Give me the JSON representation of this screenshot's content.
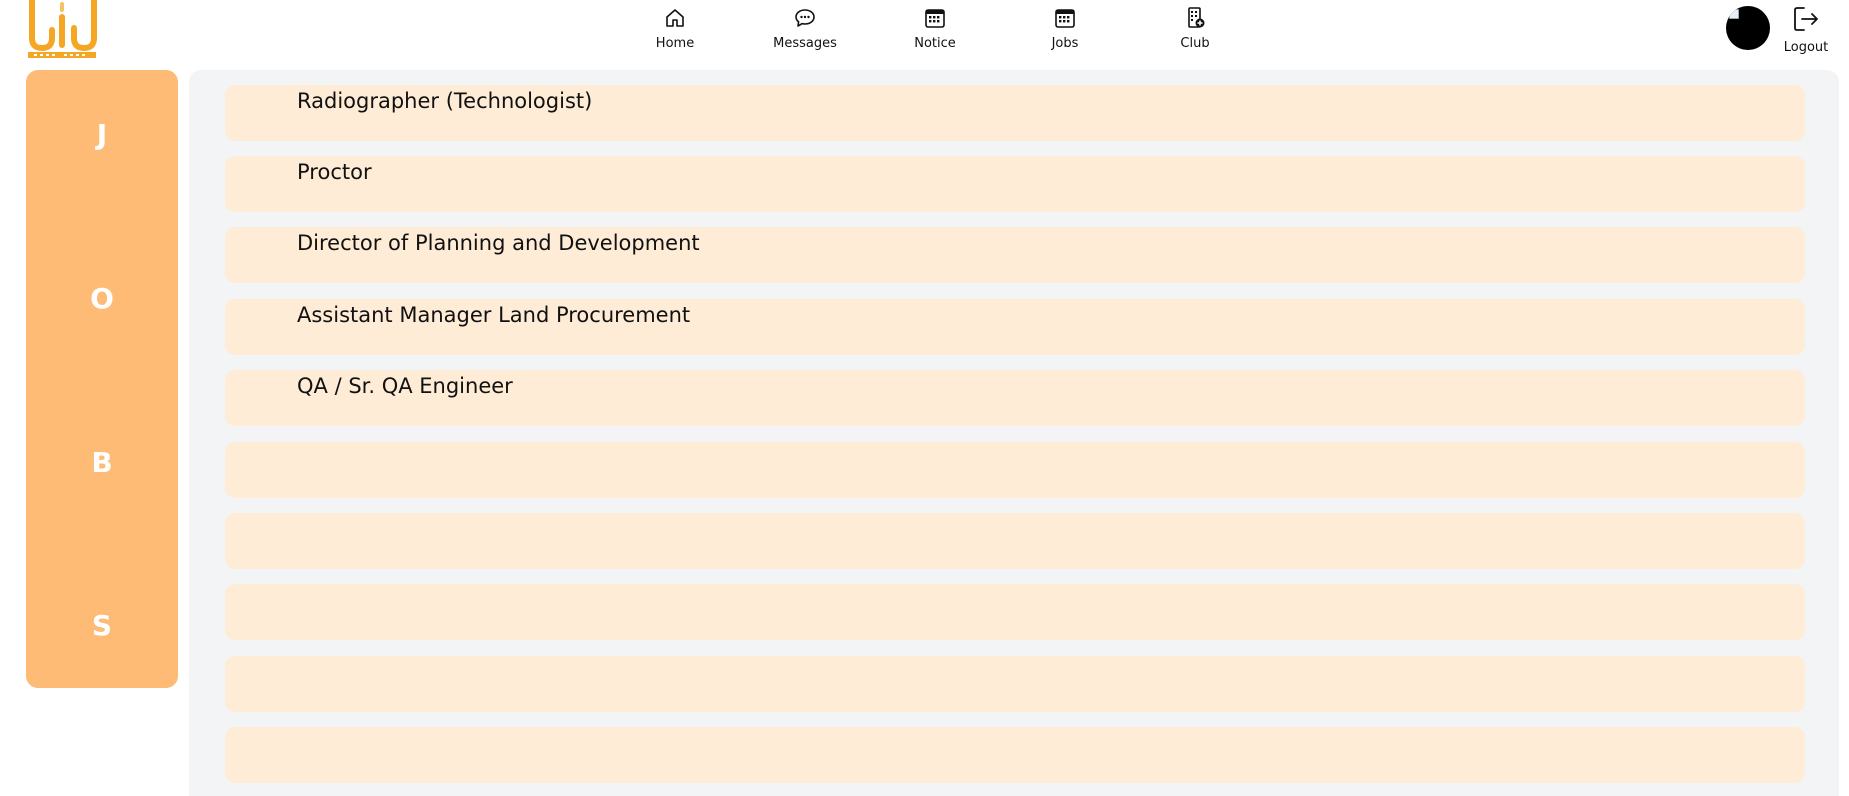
{
  "header": {
    "nav": [
      {
        "label": "Home",
        "icon": "home-icon"
      },
      {
        "label": "Messages",
        "icon": "chat-bubble-icon"
      },
      {
        "label": "Notice",
        "icon": "calendar-grid-icon"
      },
      {
        "label": "Jobs",
        "icon": "calendar-grid-icon"
      },
      {
        "label": "Club",
        "icon": "building-add-icon"
      }
    ],
    "logout_label": "Logout"
  },
  "sidebar": {
    "letters": [
      "J",
      "O",
      "B",
      "S"
    ]
  },
  "jobs": [
    {
      "title": "Radiographer (Technologist)"
    },
    {
      "title": "Proctor"
    },
    {
      "title": "Director of Planning and Development"
    },
    {
      "title": "Assistant Manager Land Procurement"
    },
    {
      "title": "QA / Sr. QA Engineer"
    },
    {
      "title": ""
    },
    {
      "title": ""
    },
    {
      "title": ""
    },
    {
      "title": ""
    },
    {
      "title": ""
    }
  ],
  "colors": {
    "brand": "#f5a623",
    "sidebar": "#fdbb76",
    "row": "#feecd6",
    "panel": "#f3f4f6"
  }
}
